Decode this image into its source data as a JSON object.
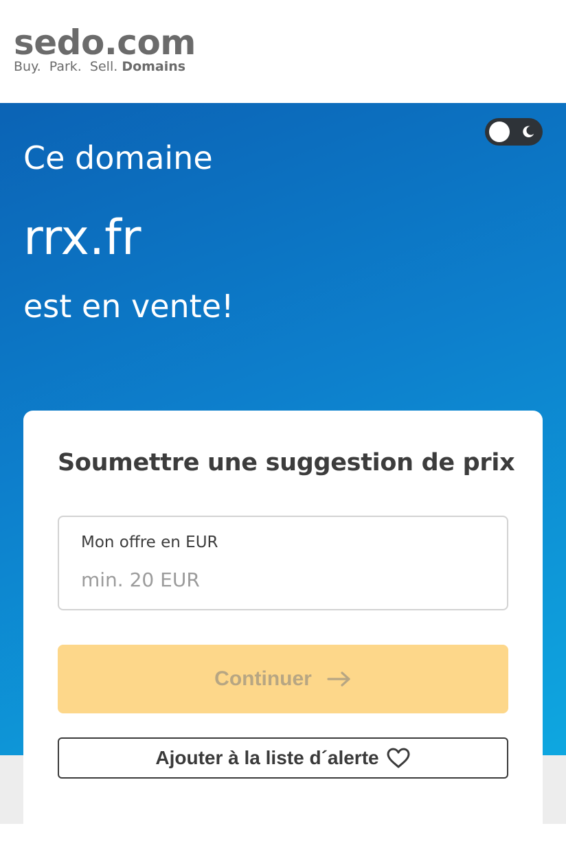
{
  "header": {
    "logo_main": "sedo.com",
    "tagline_regular": "Buy.  Park.  Sell.",
    "tagline_bold": "Domains"
  },
  "hero": {
    "line1": "Ce domaine",
    "domain": "rrx.fr",
    "line3": "est en vente!",
    "theme_toggle": {
      "knob_icon": "sun-knob-icon",
      "mode_icon": "moon-icon"
    }
  },
  "card": {
    "title": "Soumettre une suggestion de prix",
    "offer_field": {
      "label": "Mon offre en EUR",
      "value": "",
      "placeholder": "min. 20 EUR"
    },
    "continue_button": {
      "label": "Continuer",
      "icon": "arrow-right-icon"
    },
    "watchlist_button": {
      "label": "Ajouter à la liste d´alerte",
      "icon": "heart-icon"
    }
  },
  "colors": {
    "hero_gradient_start": "#0b63b5",
    "hero_gradient_end": "#0ea7e0",
    "continue_button_bg": "#fdd78a",
    "continue_button_text": "#b7a683",
    "logo_gray": "#6b6b6b",
    "title_text": "#3c3c3c",
    "toggle_bg": "#2e3338"
  }
}
